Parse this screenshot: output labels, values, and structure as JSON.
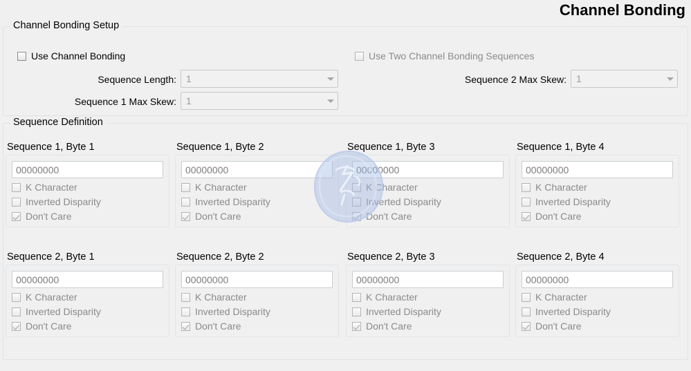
{
  "page": {
    "title": "Channel Bonding"
  },
  "setup": {
    "group_title": "Channel Bonding Setup",
    "use_channel_bonding": {
      "label": "Use Channel Bonding",
      "checked": false,
      "enabled": true
    },
    "use_two_sequences": {
      "label": "Use Two Channel Bonding Sequences",
      "checked": false,
      "enabled": false
    },
    "sequence_length": {
      "label": "Sequence Length:",
      "value": "1"
    },
    "sequence_1_max_skew": {
      "label": "Sequence 1 Max Skew:",
      "value": "1"
    },
    "sequence_2_max_skew": {
      "label": "Sequence 2 Max Skew:",
      "value": "1"
    }
  },
  "sequence_definition": {
    "group_title": "Sequence Definition",
    "checkbox_labels": {
      "k_character": "K Character",
      "inverted_disparity": "Inverted Disparity",
      "dont_care": "Don't Care"
    },
    "bytes": [
      {
        "title": "Sequence 1, Byte 1",
        "value": "00000000",
        "k_character": false,
        "inverted_disparity": false,
        "dont_care": true
      },
      {
        "title": "Sequence 1, Byte 2",
        "value": "00000000",
        "k_character": false,
        "inverted_disparity": false,
        "dont_care": true
      },
      {
        "title": "Sequence 1, Byte 3",
        "value": "00000000",
        "k_character": false,
        "inverted_disparity": false,
        "dont_care": true
      },
      {
        "title": "Sequence 1, Byte 4",
        "value": "00000000",
        "k_character": false,
        "inverted_disparity": false,
        "dont_care": true
      },
      {
        "title": "Sequence 2, Byte 1",
        "value": "00000000",
        "k_character": false,
        "inverted_disparity": false,
        "dont_care": true
      },
      {
        "title": "Sequence 2, Byte 2",
        "value": "00000000",
        "k_character": false,
        "inverted_disparity": false,
        "dont_care": true
      },
      {
        "title": "Sequence 2, Byte 3",
        "value": "00000000",
        "k_character": false,
        "inverted_disparity": false,
        "dont_care": true
      },
      {
        "title": "Sequence 2, Byte 4",
        "value": "00000000",
        "k_character": false,
        "inverted_disparity": false,
        "dont_care": true
      }
    ]
  },
  "colors": {
    "background": "#f0f0f0",
    "border": "#dfe2e5",
    "disabled_text": "#8a8a8a",
    "input_text": "#7d7d7d",
    "watermark": "#9ab4e0"
  }
}
